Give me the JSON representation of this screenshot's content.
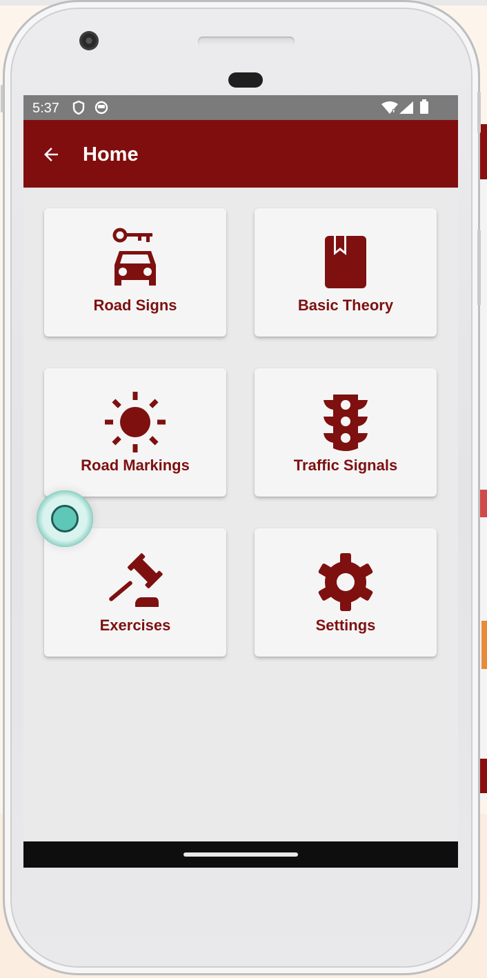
{
  "status_bar": {
    "time": "5:37"
  },
  "app_bar": {
    "title": "Home"
  },
  "menu": {
    "items": [
      {
        "label": "Road Signs",
        "icon": "car-key-icon"
      },
      {
        "label": "Basic Theory",
        "icon": "bookmark-book-icon"
      },
      {
        "label": "Road Markings",
        "icon": "sun-icon"
      },
      {
        "label": "Traffic Signals",
        "icon": "traffic-light-icon"
      },
      {
        "label": "Exercises",
        "icon": "gavel-icon"
      },
      {
        "label": "Settings",
        "icon": "gear-icon"
      }
    ]
  },
  "colors": {
    "primary": "#810e0e",
    "accent_text": "#7e1010",
    "card_background": "#f5f5f5",
    "screen_background": "#eaeaea",
    "status_bar": "#7b7b7b"
  }
}
